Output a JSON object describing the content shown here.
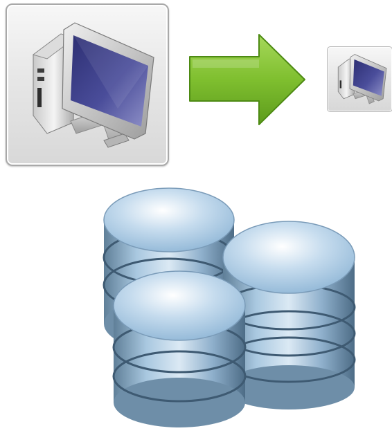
{
  "icons": {
    "computer_large": "desktop-computer-icon",
    "arrow": "right-arrow-icon",
    "computer_small": "desktop-computer-icon",
    "database": "database-stack-icon"
  },
  "colors": {
    "arrow_green": "#7fbf2f",
    "arrow_dark": "#4d8a13",
    "monitor_screen": "#3d3f8a",
    "database_blue": "#8fb6d6"
  }
}
